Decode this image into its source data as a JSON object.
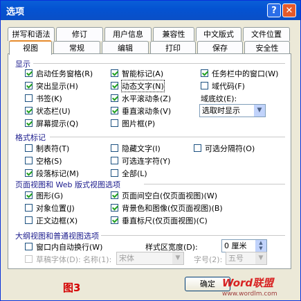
{
  "window": {
    "title": "选项",
    "help_glyph": "?",
    "close_glyph": "✕"
  },
  "tabs_row1": [
    "拼写和语法",
    "修订",
    "用户信息",
    "兼容性",
    "中文版式",
    "文件位置"
  ],
  "tabs_row2": [
    "视图",
    "常规",
    "编辑",
    "打印",
    "保存",
    "安全性"
  ],
  "active_tab": "视图",
  "display": {
    "title": "显示",
    "items": [
      {
        "label": "启动任务窗格(R)",
        "checked": true
      },
      {
        "label": "智能标记(A)",
        "checked": true
      },
      {
        "label": "任务栏中的窗口(W)",
        "checked": true
      },
      {
        "label": "突出显示(H)",
        "checked": true
      },
      {
        "label": "动态文字(N)",
        "checked": true
      },
      {
        "label": "域代码(F)",
        "checked": false
      },
      {
        "label": "书签(K)",
        "checked": false
      },
      {
        "label": "水平滚动条(Z)",
        "checked": true
      },
      {
        "label": "状态栏(U)",
        "checked": true
      },
      {
        "label": "垂直滚动条(V)",
        "checked": true
      },
      {
        "label": "屏幕提示(Q)",
        "checked": true
      },
      {
        "label": "图片框(P)",
        "checked": false
      }
    ],
    "field_shading_label": "域底纹(E):",
    "field_shading_value": "选取时显示"
  },
  "format_marks": {
    "title": "格式标记",
    "items": [
      {
        "label": "制表符(T)",
        "checked": false
      },
      {
        "label": "隐藏文字(I)",
        "checked": false
      },
      {
        "label": "可选分隔符(O)",
        "checked": false
      },
      {
        "label": "空格(S)",
        "checked": false
      },
      {
        "label": "可选连字符(Y)",
        "checked": false
      },
      {
        "label": "段落标记(M)",
        "checked": true
      },
      {
        "label": "全部(L)",
        "checked": false
      }
    ]
  },
  "layout_options": {
    "title": "页面视图和 Web 版式视图选项",
    "items": [
      {
        "label": "图形(G)",
        "checked": true
      },
      {
        "label": "页面间空白(仅页面视图)(W)",
        "checked": true
      },
      {
        "label": "对象位置(J)",
        "checked": false
      },
      {
        "label": "背景色和图像(仅页面视图)(B)",
        "checked": true
      },
      {
        "label": "正文边框(X)",
        "checked": false
      },
      {
        "label": "垂直标尺(仅页面视图)(C)",
        "checked": true
      }
    ]
  },
  "outline_options": {
    "title": "大纲视图和普通视图选项",
    "wrap_label": "窗口内自动换行(W)",
    "wrap_checked": false,
    "style_width_label": "样式区宽度(D):",
    "style_width_value": "0 厘米",
    "draft_font_label": "草稿字体(D):",
    "name_label": "名称(1):",
    "name_value": "宋体",
    "size_label": "字号(2):",
    "size_value": "五号"
  },
  "buttons": {
    "ok": "确定"
  },
  "caption": "图3",
  "watermark": {
    "brand": "Word联盟",
    "url": "www.wordlm.com"
  }
}
